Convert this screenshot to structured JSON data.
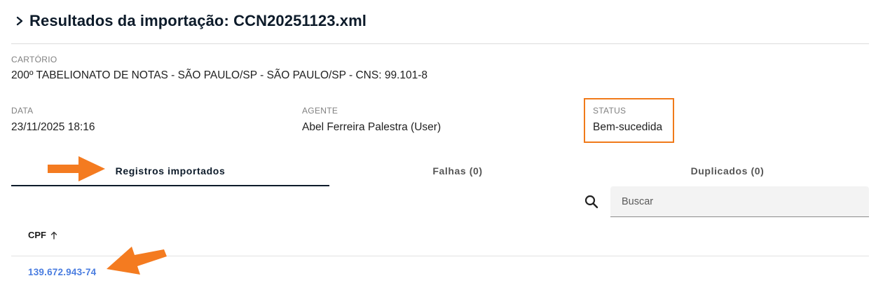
{
  "header": {
    "title": "Resultados da importação: CCN20251123.xml"
  },
  "cartorio": {
    "label": "CARTÓRIO",
    "value": "200º TABELIONATO DE NOTAS - SÃO PAULO/SP - SÃO PAULO/SP - CNS: 99.101-8"
  },
  "data": {
    "label": "DATA",
    "value": "23/11/2025 18:16"
  },
  "agente": {
    "label": "AGENTE",
    "value": "Abel Ferreira Palestra (User)"
  },
  "status": {
    "label": "STATUS",
    "value": "Bem-sucedida"
  },
  "tabs": [
    {
      "label": "Registros importados",
      "active": true
    },
    {
      "label": "Falhas (0)",
      "active": false
    },
    {
      "label": "Duplicados (0)",
      "active": false
    }
  ],
  "search": {
    "placeholder": "Buscar",
    "value": ""
  },
  "table": {
    "columns": [
      {
        "label": "CPF",
        "sort": "asc"
      }
    ],
    "rows": [
      {
        "cpf": "139.672.943-74"
      }
    ]
  },
  "colors": {
    "accent": "#0d1b2a",
    "link": "#4a7de0",
    "highlight": "#f07a1a"
  },
  "icons": {
    "header": "chevron-right-icon",
    "search": "search-icon",
    "sort": "arrow-up-icon",
    "annotation": "arrow-annotation-icon"
  }
}
